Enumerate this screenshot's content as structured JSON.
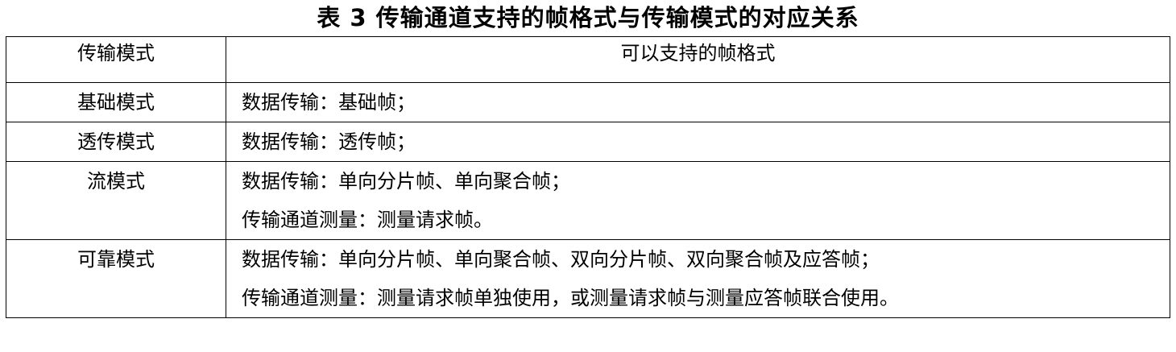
{
  "caption": "表 3 传输通道支持的帧格式与传输模式的对应关系",
  "table": {
    "headers": {
      "mode": "传输模式",
      "frames": "可以支持的帧格式"
    },
    "rows": [
      {
        "mode": "基础模式",
        "lines": [
          "数据传输：基础帧；"
        ]
      },
      {
        "mode": "透传模式",
        "lines": [
          "数据传输：透传帧；"
        ]
      },
      {
        "mode": "流模式",
        "lines": [
          "数据传输：单向分片帧、单向聚合帧；",
          "传输通道测量：测量请求帧。"
        ]
      },
      {
        "mode": "可靠模式",
        "lines": [
          "数据传输：单向分片帧、单向聚合帧、双向分片帧、双向聚合帧及应答帧；",
          "传输通道测量：测量请求帧单独使用，或测量请求帧与测量应答帧联合使用。"
        ]
      }
    ]
  }
}
